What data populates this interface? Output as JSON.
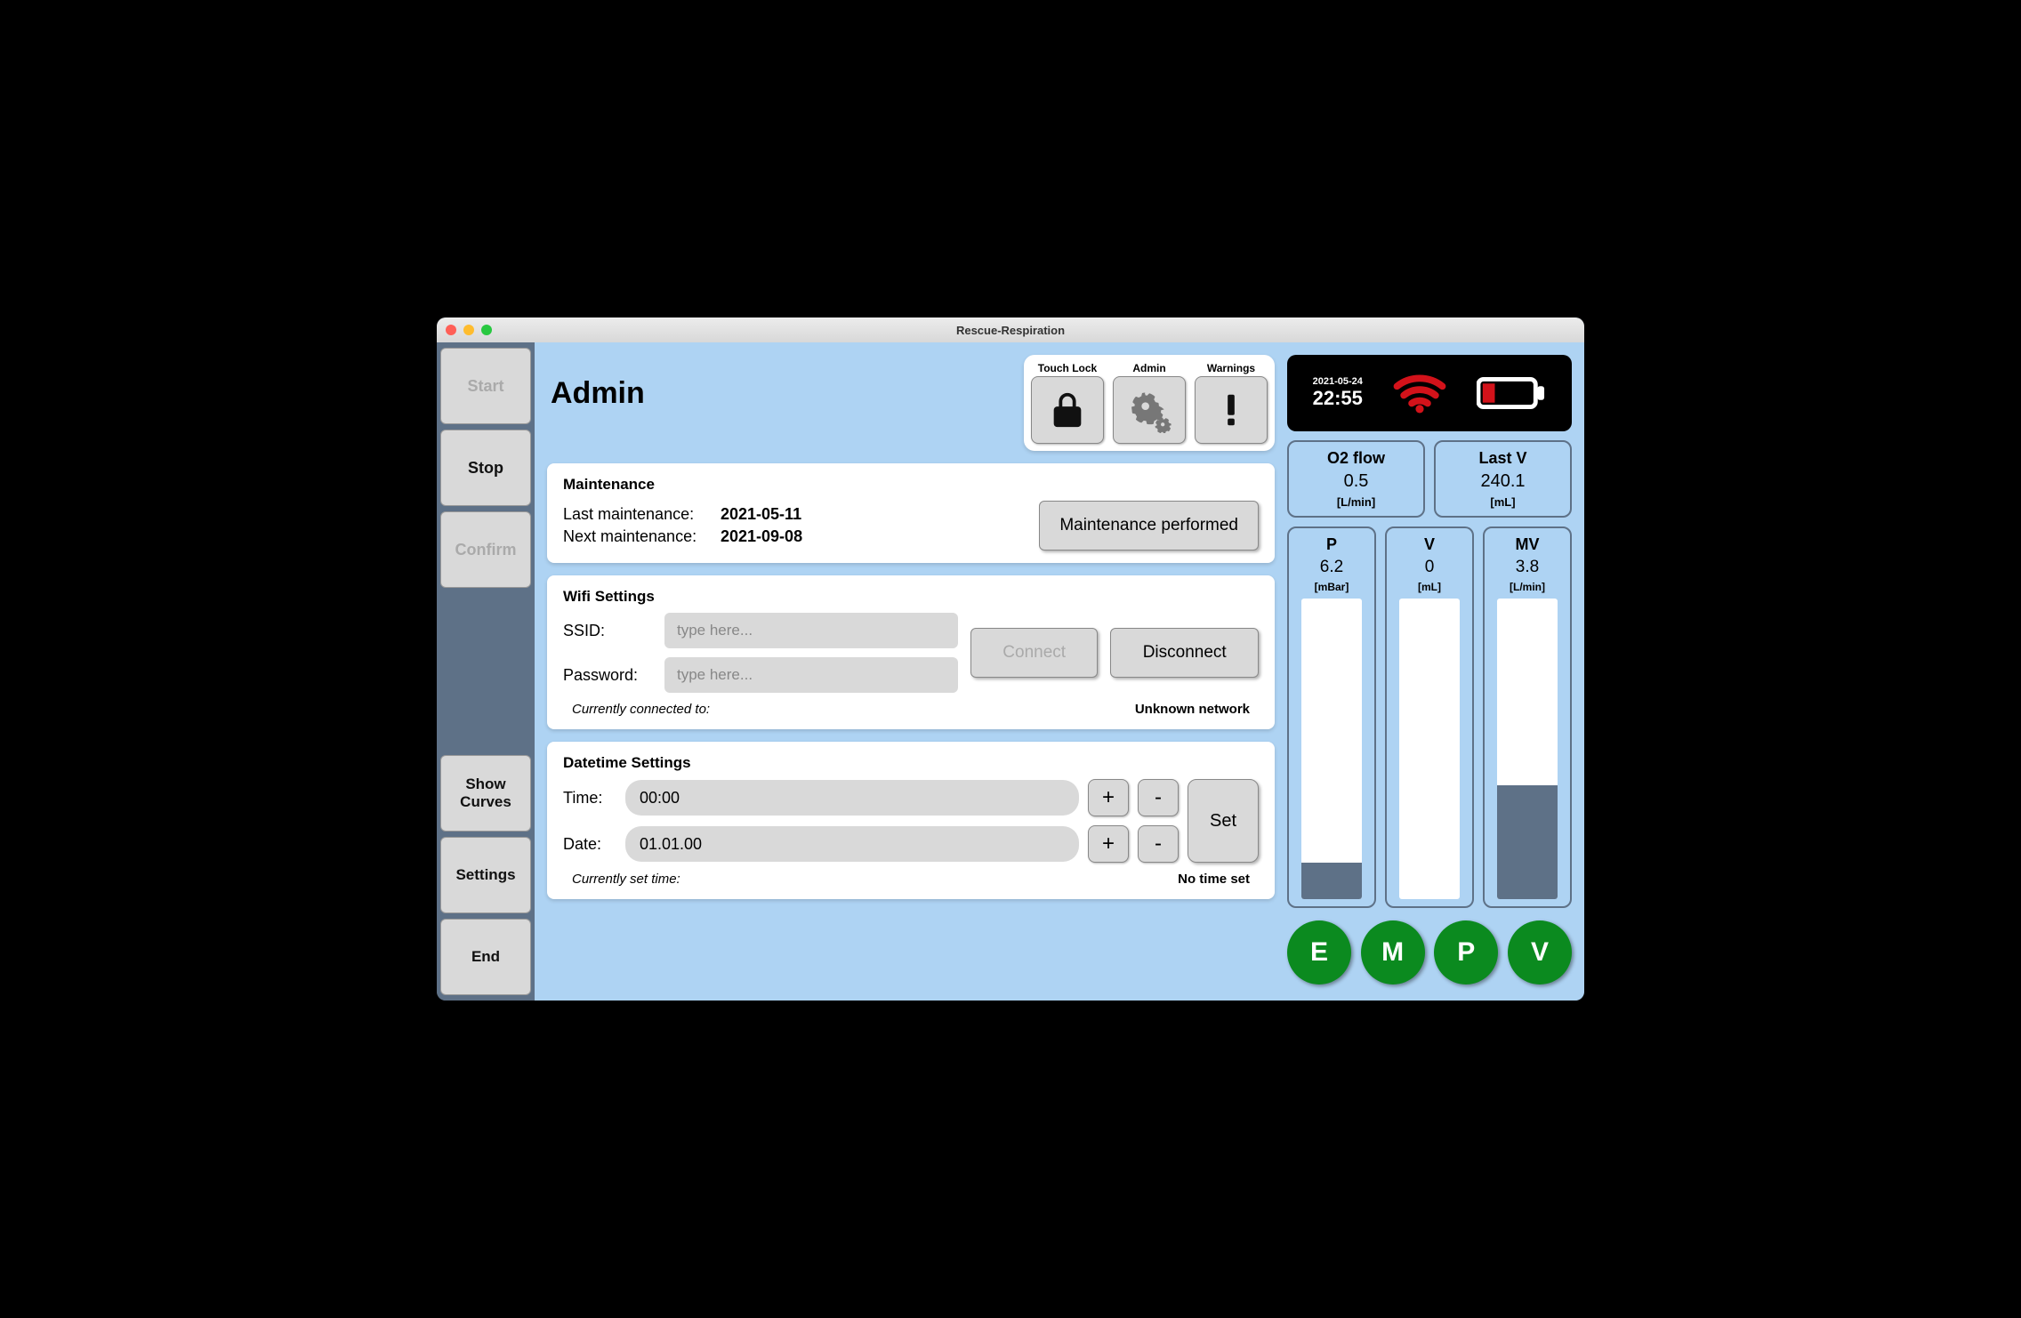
{
  "window": {
    "title": "Rescue-Respiration"
  },
  "sidebar": {
    "start": "Start",
    "stop": "Stop",
    "confirm": "Confirm",
    "show_curves": "Show Curves",
    "settings": "Settings",
    "end": "End"
  },
  "page": {
    "title": "Admin"
  },
  "header_buttons": {
    "touch_lock": "Touch Lock",
    "admin": "Admin",
    "warnings": "Warnings"
  },
  "maintenance": {
    "heading": "Maintenance",
    "last_label": "Last maintenance:",
    "last_value": "2021-05-11",
    "next_label": "Next maintenance:",
    "next_value": "2021-09-08",
    "button": "Maintenance performed"
  },
  "wifi": {
    "heading": "Wifi Settings",
    "ssid_label": "SSID:",
    "ssid_placeholder": "type here...",
    "password_label": "Password:",
    "password_placeholder": "type here...",
    "connect": "Connect",
    "disconnect": "Disconnect",
    "status_label": "Currently connected to:",
    "status_value": "Unknown network"
  },
  "datetime": {
    "heading": "Datetime Settings",
    "time_label": "Time:",
    "time_value": "00:00",
    "date_label": "Date:",
    "date_value": "01.01.00",
    "set": "Set",
    "status_label": "Currently set time:",
    "status_value": "No time set",
    "plus": "+",
    "minus": "-"
  },
  "status": {
    "date": "2021-05-24",
    "time": "22:55"
  },
  "metrics": {
    "o2": {
      "title": "O2 flow",
      "value": "0.5",
      "unit": "[L/min]"
    },
    "lastv": {
      "title": "Last V",
      "value": "240.1",
      "unit": "[mL]"
    },
    "p": {
      "title": "P",
      "value": "6.2",
      "unit": "[mBar]",
      "fill_pct": 12
    },
    "v": {
      "title": "V",
      "value": "0",
      "unit": "[mL]",
      "fill_pct": 0
    },
    "mv": {
      "title": "MV",
      "value": "3.8",
      "unit": "[L/min]",
      "fill_pct": 38
    }
  },
  "badges": [
    "E",
    "M",
    "P",
    "V"
  ],
  "colors": {
    "wifi": "#d3121a",
    "battery_fill": "#d3121a",
    "badge": "#0b8a1f"
  }
}
